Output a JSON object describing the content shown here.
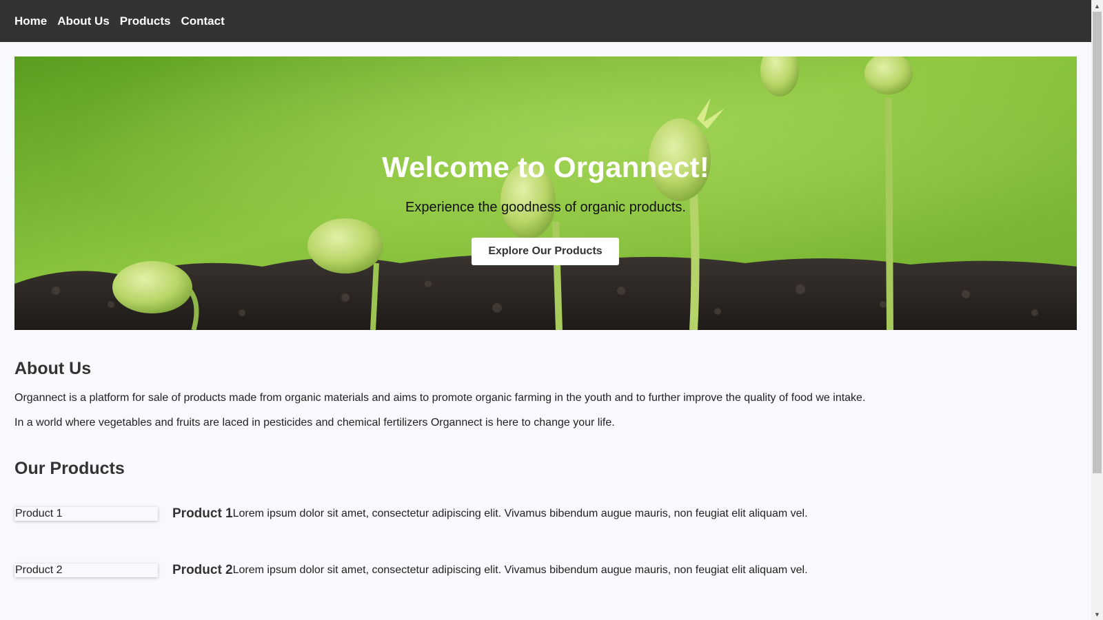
{
  "nav": {
    "items": [
      {
        "label": "Home"
      },
      {
        "label": "About Us"
      },
      {
        "label": "Products"
      },
      {
        "label": "Contact"
      }
    ]
  },
  "hero": {
    "title": "Welcome to Organnect!",
    "subtitle": "Experience the goodness of organic products.",
    "button_label": "Explore Our Products"
  },
  "about": {
    "title": "About Us",
    "paragraphs": [
      "Organnect is a platform for sale of products made from organic materials and aims to promote organic farming in the youth and to further improve the quality of food we intake.",
      "In a world where vegetables and fruits are laced in pesticides and chemical fertilizers Organnect is here to change your life."
    ]
  },
  "products": {
    "title": "Our Products",
    "items": [
      {
        "image_alt": "Product 1",
        "name": "Product 1",
        "description": "Lorem ipsum dolor sit amet, consectetur adipiscing elit. Vivamus bibendum augue mauris, non feugiat elit aliquam vel."
      },
      {
        "image_alt": "Product 2",
        "name": "Product 2",
        "description": "Lorem ipsum dolor sit amet, consectetur adipiscing elit. Vivamus bibendum augue mauris, non feugiat elit aliquam vel."
      }
    ]
  },
  "colors": {
    "navbar": "#333333",
    "background": "#f8f9fd",
    "hero_sky": "#7cc242",
    "soil": "#2b2623"
  }
}
